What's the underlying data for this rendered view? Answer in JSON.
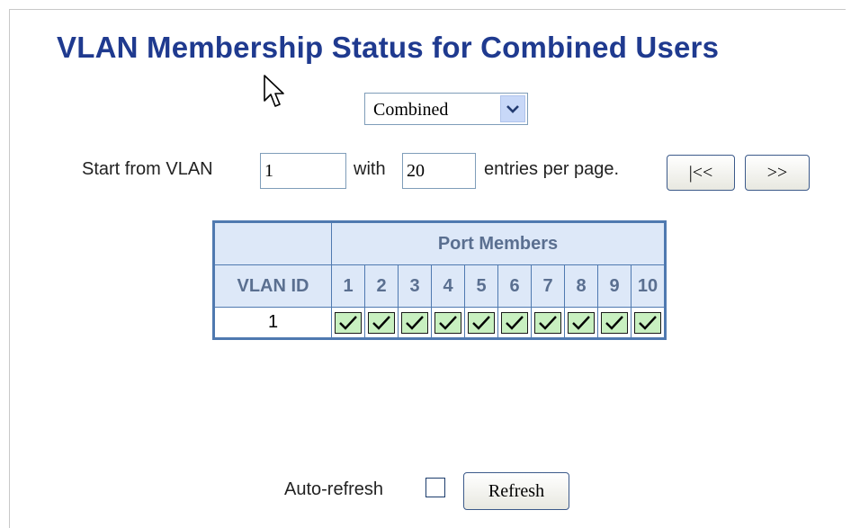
{
  "page": {
    "title": "VLAN Membership Status for Combined Users",
    "user_select": {
      "selected": "Combined"
    }
  },
  "paging": {
    "start_label": "Start from VLAN",
    "start_value": "1",
    "with_label": "with",
    "entries_value": "20",
    "per_page_label": "entries per page.",
    "first_label": "|<<",
    "next_label": ">>"
  },
  "table": {
    "group_header": "Port Members",
    "id_header": "VLAN ID",
    "ports": [
      "1",
      "2",
      "3",
      "4",
      "5",
      "6",
      "7",
      "8",
      "9",
      "10"
    ],
    "rows": [
      {
        "vlan_id": "1",
        "members": [
          true,
          true,
          true,
          true,
          true,
          true,
          true,
          true,
          true,
          true
        ]
      }
    ]
  },
  "footer": {
    "auto_refresh_label": "Auto-refresh",
    "auto_refresh_checked": false,
    "refresh_label": "Refresh"
  },
  "icons": {
    "dropdown": "chevron-down-icon",
    "member": "check-icon",
    "cursor": "mouse-pointer-icon"
  },
  "colors": {
    "title": "#1f3a8f",
    "table_border": "#4f79b0",
    "header_bg": "#dde8f8",
    "member_bg": "#c8f0c0"
  }
}
